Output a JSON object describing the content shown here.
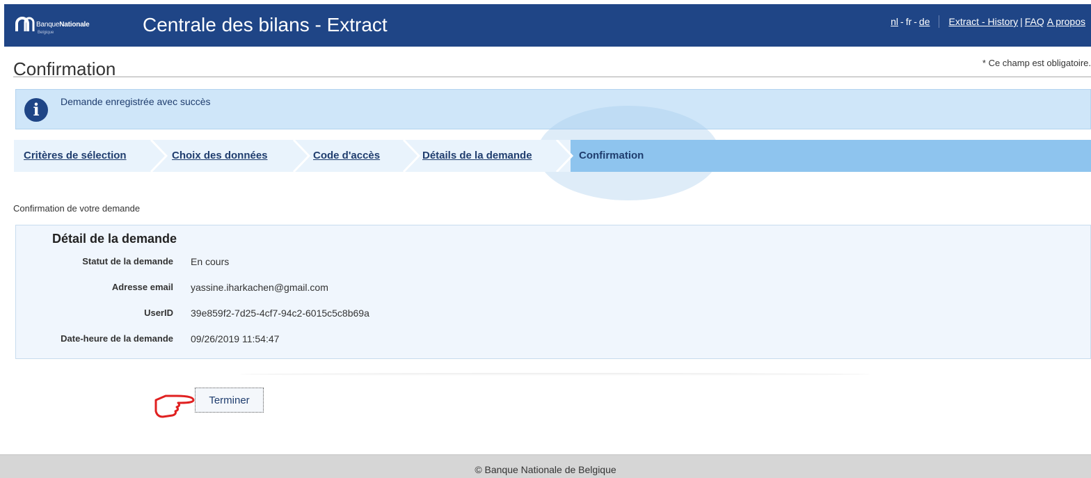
{
  "header": {
    "logo_prefix": "Banque",
    "logo_name": "Nationale",
    "logo_sub": "Belgique",
    "title": "Centrale des bilans - Extract",
    "lang": {
      "nl": "nl",
      "fr": "fr",
      "de": "de",
      "sep": "-"
    },
    "links": {
      "history": "Extract - History",
      "pipe": "|",
      "faq": "FAQ",
      "about": "A propos"
    }
  },
  "page": {
    "title": "Confirmation",
    "required_note": "* Ce champ est obligatoire."
  },
  "info": {
    "message": "Demande enregistrée avec succès",
    "icon": "info-icon"
  },
  "steps": [
    {
      "label": "Critères de sélection"
    },
    {
      "label": "Choix des données"
    },
    {
      "label": "Code d'accès"
    },
    {
      "label": "Détails de la demande"
    },
    {
      "label": "Confirmation",
      "active": true
    }
  ],
  "section_label": "Confirmation de votre demande",
  "detail": {
    "title": "Détail de la demande",
    "rows": [
      {
        "label": "Statut de la demande",
        "value": "En cours"
      },
      {
        "label": "Adresse email",
        "value": "yassine.iharkachen@gmail.com"
      },
      {
        "label": "UserID",
        "value": "39e859f2-7d25-4cf7-94c2-6015c5c8b69a"
      },
      {
        "label": "Date-heure de la demande",
        "value": "09/26/2019 11:54:47"
      }
    ]
  },
  "button": {
    "finish": "Terminer"
  },
  "footer": {
    "text": "© Banque Nationale de Belgique"
  },
  "colors": {
    "header": "#1f4586",
    "info_bg": "#cfe6f9",
    "step_active": "#8ec4ee",
    "annotation": "#e02020"
  }
}
